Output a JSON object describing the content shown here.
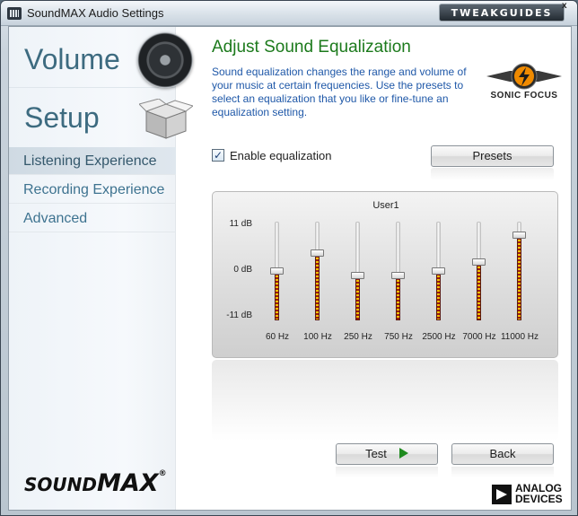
{
  "window": {
    "title": "SoundMAX Audio Settings",
    "watermark": "TWEAKGUIDES",
    "close_glyph": "x"
  },
  "sidebar": {
    "primary": [
      {
        "label": "Volume",
        "icon": "speaker-icon"
      },
      {
        "label": "Setup",
        "icon": "box-icon"
      }
    ],
    "items": [
      {
        "label": "Listening Experience",
        "active": true
      },
      {
        "label": "Recording Experience",
        "active": false
      },
      {
        "label": "Advanced",
        "active": false
      }
    ],
    "logo": {
      "part1": "SOUND",
      "part2": "MAX",
      "reg": "®"
    }
  },
  "main": {
    "heading": "Adjust Sound Equalization",
    "description": "Sound equalization changes the range and volume of your music at certain frequencies. Use the presets to select an equalization that you like or fine-tune an equalization setting.",
    "partner_logo": "SONIC FOCUS",
    "enable_checkbox": {
      "label": "Enable equalization",
      "checked": true,
      "mark": "✓"
    },
    "presets_button": "Presets",
    "equalizer": {
      "preset_name": "User1",
      "db_labels": [
        "11 dB",
        "0 dB",
        "-11 dB"
      ],
      "range_db": [
        -11,
        11
      ],
      "bands": [
        {
          "freq": "60 Hz",
          "gain_db": 0
        },
        {
          "freq": "100 Hz",
          "gain_db": 4
        },
        {
          "freq": "250 Hz",
          "gain_db": -1
        },
        {
          "freq": "750 Hz",
          "gain_db": -1
        },
        {
          "freq": "2500 Hz",
          "gain_db": 0
        },
        {
          "freq": "7000 Hz",
          "gain_db": 2
        },
        {
          "freq": "11000 Hz",
          "gain_db": 8
        }
      ]
    },
    "test_button": "Test",
    "back_button": "Back",
    "vendor_logo": {
      "line1": "ANALOG",
      "line2": "DEVICES"
    }
  },
  "colors": {
    "heading": "#1c7a1c",
    "description": "#1f58a8",
    "nav": "#3d6b80",
    "eq_fill_a": "#f2c200",
    "eq_fill_b": "#9a1a12",
    "play": "#1e8a1e"
  }
}
